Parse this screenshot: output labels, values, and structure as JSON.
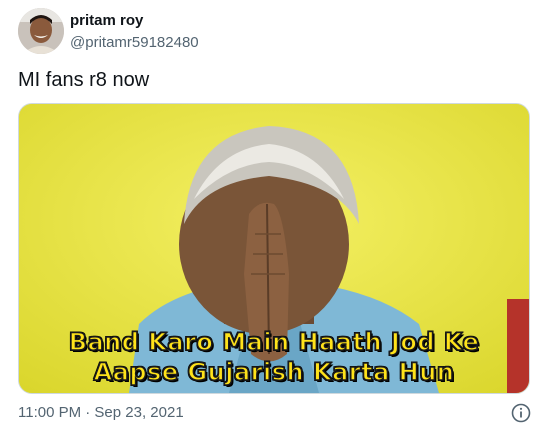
{
  "author": {
    "display_name": "pritam roy",
    "handle": "@pritamr59182480",
    "avatar_icon": "profile-photo"
  },
  "tweet": {
    "text": "MI fans r8 now",
    "timestamp": "11:00 PM · Sep 23, 2021"
  },
  "media": {
    "caption_line_1": "Band Karo Main Haath Jod Ke",
    "caption_line_2": "Aapse Gujarish Karta Hun",
    "caption_color": "#ffe31a",
    "background_color": "#e9e43a"
  },
  "icons": {
    "info": "info-icon"
  }
}
